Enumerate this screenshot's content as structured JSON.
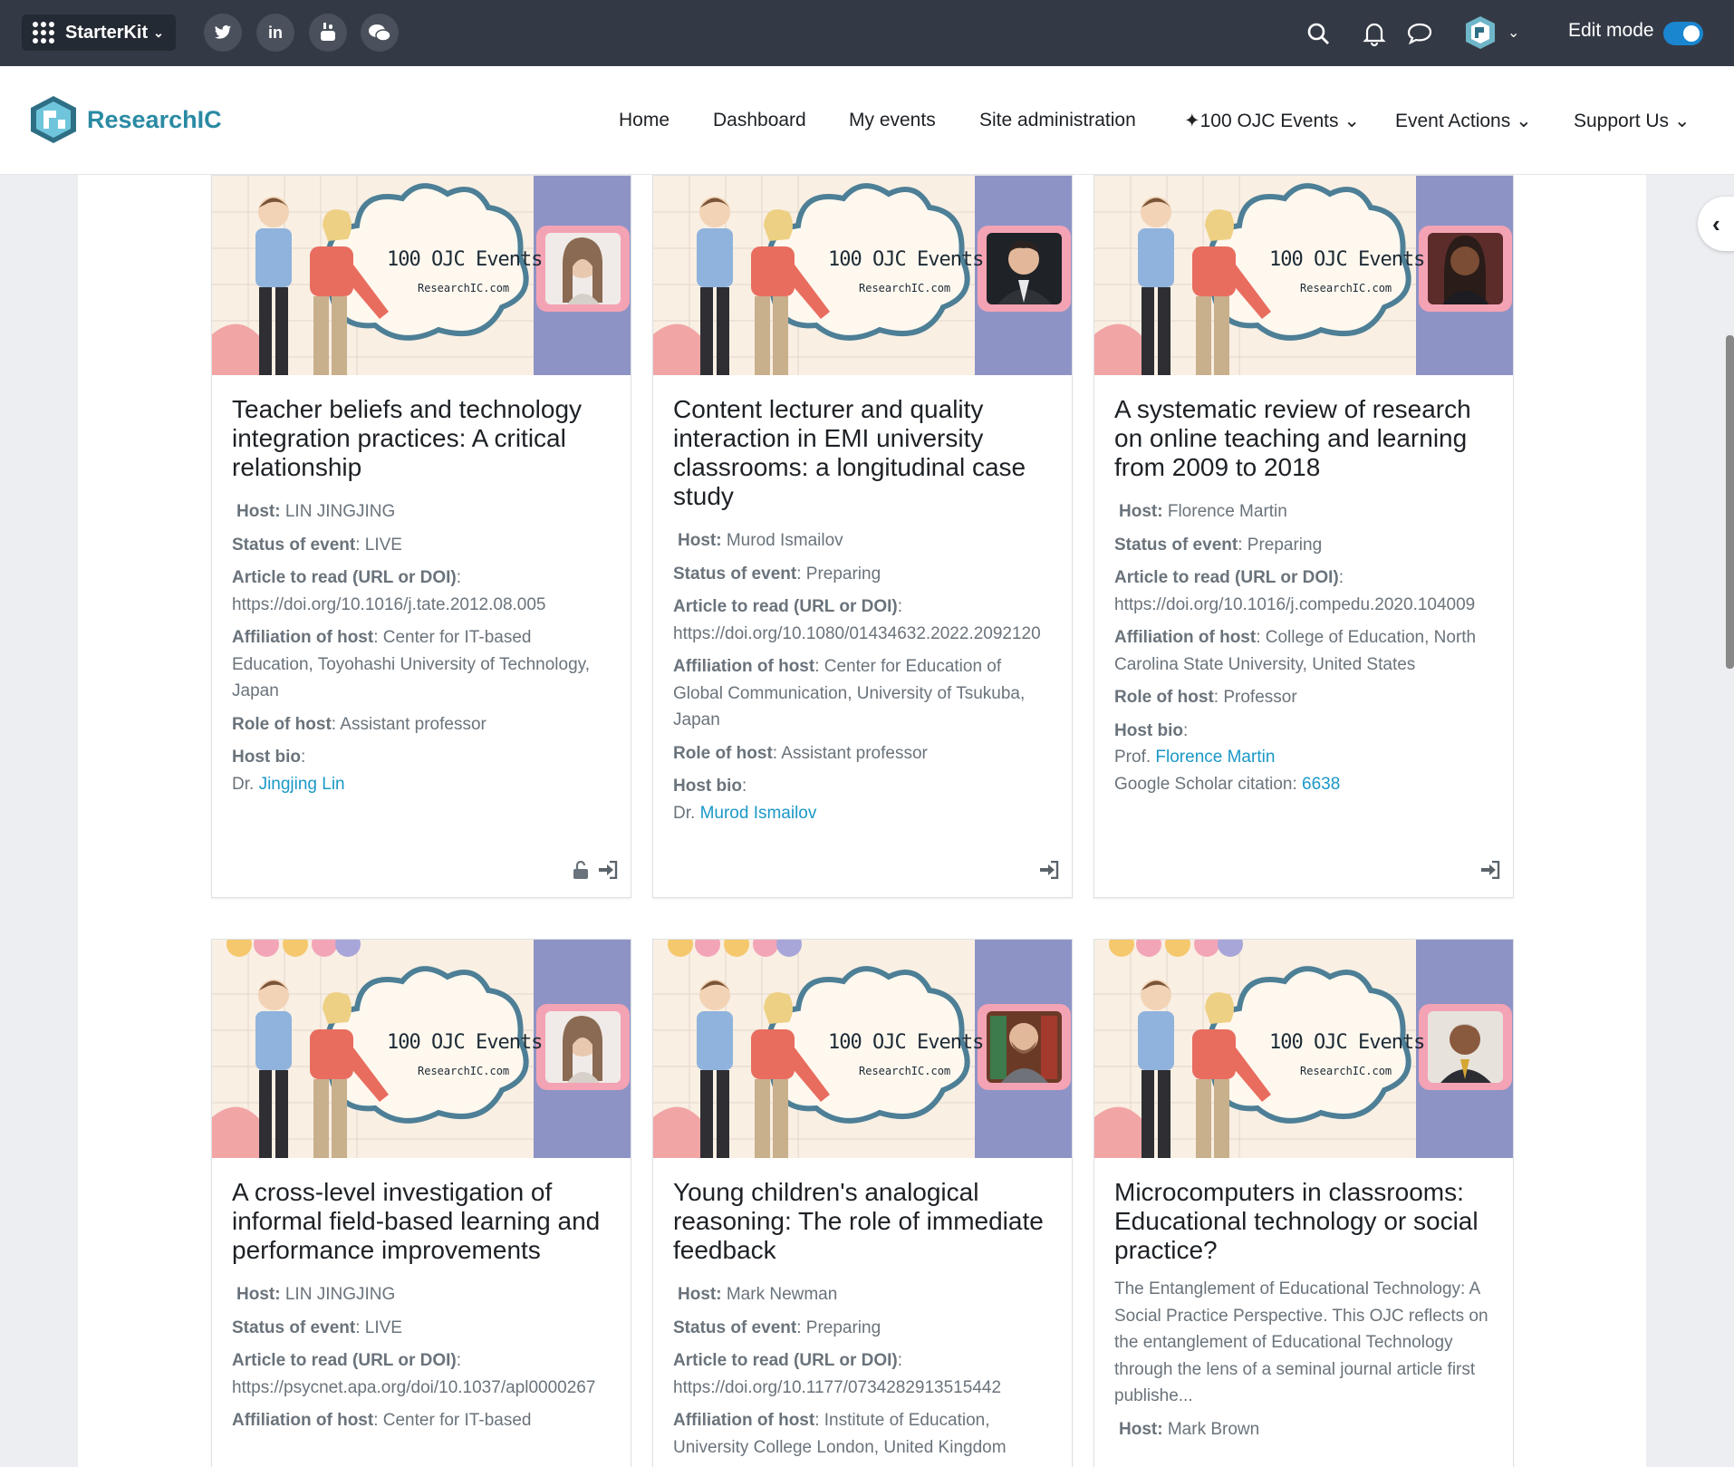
{
  "topbar": {
    "app_menu_label": "StarterKit",
    "social": [
      {
        "icon": "twitter-icon",
        "glyph": ""
      },
      {
        "icon": "linkedin-icon",
        "glyph": "in"
      },
      {
        "icon": "youtube-icon",
        "glyph": ""
      },
      {
        "icon": "wechat-icon",
        "glyph": ""
      }
    ],
    "edit_mode_label": "Edit mode",
    "edit_mode_on": true
  },
  "brand": {
    "name": "ResearchIC"
  },
  "nav": [
    {
      "label": "Home"
    },
    {
      "label": "Dashboard"
    },
    {
      "label": "My events"
    },
    {
      "label": "Site administration"
    },
    {
      "label": "✦100 OJC Events ⌄"
    },
    {
      "label": "Event Actions ⌄"
    },
    {
      "label": "Support Us ⌄"
    }
  ],
  "banner": {
    "title": "100 OJC Events",
    "site": "ResearchIC.com"
  },
  "labels": {
    "host": "Host:",
    "status": "Status of event",
    "article": "Article to read (URL or DOI)",
    "affiliation": "Affiliation of host",
    "role": "Role of host",
    "bio": "Host bio",
    "colon": ":"
  },
  "cards": [
    {
      "title": "Teacher beliefs and technology integration practices: A critical relationship",
      "host": "LIN JINGJING",
      "status": "LIVE",
      "article": "https://doi.org/10.1016/j.tate.2012.08.005",
      "affiliation": "Center for IT-based Education, Toyohashi University of Technology, Japan",
      "role": "Assistant professor",
      "bio_prefix": "Dr.",
      "bio_name": "Jingjing Lin"
    },
    {
      "title": "Content lecturer and quality interaction in EMI university classrooms: a longitudinal case study",
      "host": "Murod Ismailov",
      "status": "Preparing",
      "article": "https://doi.org/10.1080/01434632.2022.2092120",
      "affiliation": "Center for Education of Global Communication, University of Tsukuba, Japan",
      "role": "Assistant professor",
      "bio_prefix": "Dr.",
      "bio_name": "Murod Ismailov"
    },
    {
      "title": "A systematic review of research on online teaching and learning from 2009 to 2018",
      "host": "Florence Martin",
      "status": "Preparing",
      "article": "https://doi.org/10.1016/j.compedu.2020.104009",
      "affiliation": "College of Education, North Carolina State University, United States",
      "role": "Professor",
      "bio_prefix": "Prof.",
      "bio_name": "Florence Martin",
      "citation_label": "Google Scholar citation:",
      "citation_value": "6638"
    },
    {
      "title": "A cross-level investigation of informal field-based learning and performance improvements",
      "host": "LIN JINGJING",
      "status": "LIVE",
      "article": "https://psycnet.apa.org/doi/10.1037/apl0000267",
      "affiliation_partial": "Center for IT-based"
    },
    {
      "title": "Young children's analogical reasoning: The role of immediate feedback",
      "host": "Mark Newman",
      "status": "Preparing",
      "article": "https://doi.org/10.1177/0734282913515442",
      "affiliation": "Institute of Education, University College London, United Kingdom"
    },
    {
      "title": "Microcomputers in classrooms: Educational technology or social practice?",
      "summary": "The Entanglement of Educational Technology: A Social Practice Perspective. This OJC reflects on the entanglement of Educational Technology through the lens of a seminal journal article first publishe...",
      "host": "Mark Brown"
    }
  ]
}
